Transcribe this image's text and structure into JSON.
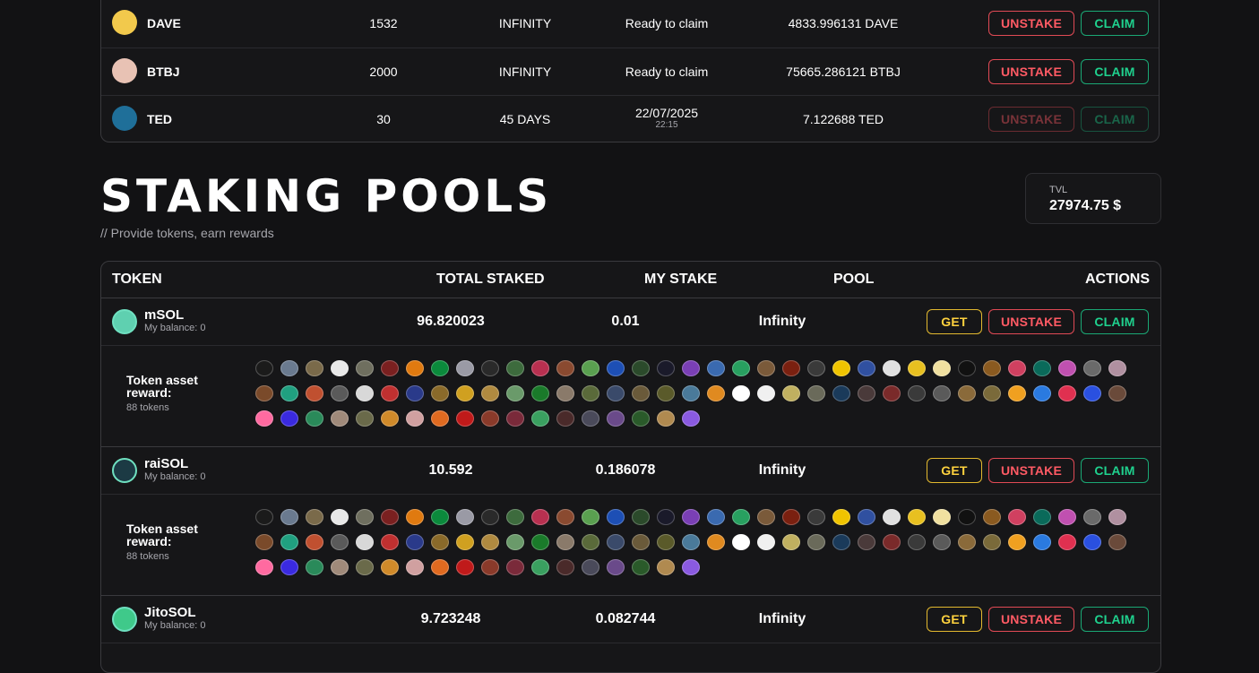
{
  "my_stakes": {
    "rows": [
      {
        "token": "DAVE",
        "amount": "1532",
        "duration": "INFINITY",
        "status": "Ready to claim",
        "status_time": "",
        "reward": "4833.996131 DAVE",
        "icon": "dave-token-icon",
        "color": "#f2c94c",
        "enabled": true
      },
      {
        "token": "BTBJ",
        "amount": "2000",
        "duration": "INFINITY",
        "status": "Ready to claim",
        "status_time": "",
        "reward": "75665.286121 BTBJ",
        "icon": "btbj-token-icon",
        "color": "#e8c2b4",
        "enabled": true
      },
      {
        "token": "TED",
        "amount": "30",
        "duration": "45 DAYS",
        "status": "22/07/2025",
        "status_time": "22:15",
        "reward": "7.122688 TED",
        "icon": "ted-token-icon",
        "color": "#1f6f99",
        "enabled": false
      }
    ],
    "unstake_label": "UNSTAKE",
    "claim_label": "CLAIM"
  },
  "section": {
    "title": "STAKING POOLS",
    "subtitle": "// Provide tokens, earn rewards",
    "tvl_label": "TVL",
    "tvl_value": "27974.75 $"
  },
  "table": {
    "headers": {
      "token": "TOKEN",
      "total_staked": "TOTAL STAKED",
      "my_stake": "MY STAKE",
      "pool": "POOL",
      "actions": "ACTIONS"
    },
    "get_label": "GET",
    "unstake_label": "UNSTAKE",
    "claim_label": "CLAIM",
    "reward_label": "Token asset reward:",
    "pools": [
      {
        "name": "mSOL",
        "balance": "My balance: 0",
        "total": "96.820023",
        "mine": "0.01",
        "pool": "Infinity",
        "reward_count": "88 tokens",
        "color": "#5fd0b0"
      },
      {
        "name": "raiSOL",
        "balance": "My balance: 0",
        "total": "10.592",
        "mine": "0.186078",
        "pool": "Infinity",
        "reward_count": "88 tokens",
        "color": "#1c3a44"
      },
      {
        "name": "JitoSOL",
        "balance": "My balance: 0",
        "total": "9.723248",
        "mine": "0.082744",
        "pool": "Infinity",
        "reward_count": "",
        "color": "#3fc98a"
      }
    ]
  },
  "reward_token_colors": [
    "#1b1b1b",
    "#6a7a8f",
    "#7a6a4a",
    "#e8e8e8",
    "#6f6f5f",
    "#7a2020",
    "#e07a10",
    "#0b8a3c",
    "#9a9aa5",
    "#2a2a2a",
    "#3d6b3d",
    "#b83050",
    "#8a4a30",
    "#5aa050",
    "#1d4fb5",
    "#2b4a2b",
    "#1a1a2a",
    "#7a3fb5",
    "#3a6ab0",
    "#28a060",
    "#7a5a3a",
    "#7a2010",
    "#3a3a3a",
    "#f0c400",
    "#3050a0",
    "#e0e0e0",
    "#e8c020",
    "#f0e0a0",
    "#111111",
    "#8a5a20",
    "#d04060",
    "#0a6a5a",
    "#c050b0",
    "#6a6a6a",
    "#b090a0",
    "#7a4a2a",
    "#20a080",
    "#c05030",
    "#5a5a5a",
    "#d8d8d8",
    "#c03030",
    "#2a3a8a",
    "#8a6a2a",
    "#d0a020",
    "#b08a40",
    "#6a9a6a",
    "#1a7a2a",
    "#8a7a6a",
    "#5a6a3a",
    "#3a4a6a",
    "#6a5a3a",
    "#5a5a2a",
    "#4a7a9a",
    "#e08a20",
    "#ffffff",
    "#f0f0f0",
    "#c0b060",
    "#6a6a5a",
    "#1a3a5a",
    "#4a3a3a",
    "#7a2a2a",
    "#3a3a3a",
    "#5a5a5a",
    "#8a6a3a",
    "#7a6a3a",
    "#f0a020",
    "#2a7ae0",
    "#e03050",
    "#2a50e0",
    "#6a4a3a",
    "#ff6aa0",
    "#3a2ae0",
    "#2a8a5a",
    "#a08a7a",
    "#6a6a4a",
    "#d08a2a",
    "#d0a0a0",
    "#e06a20",
    "#c01a1a",
    "#8a3a2a",
    "#7a2a3a",
    "#3aa060",
    "#4a2a2a",
    "#4a4a5a",
    "#6a4a8a",
    "#2a5a2a",
    "#b08a50",
    "#8a5ae0"
  ]
}
